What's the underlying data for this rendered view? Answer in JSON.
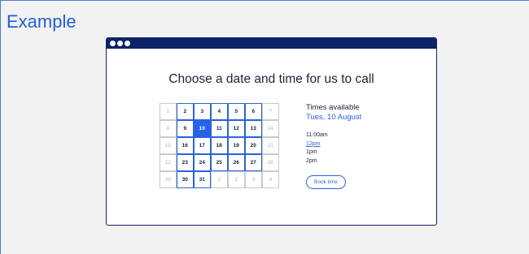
{
  "page": {
    "heading": "Example"
  },
  "window": {
    "title": "Choose a date and time for us to call"
  },
  "calendar": {
    "cells": [
      {
        "label": "1",
        "state": "muted"
      },
      {
        "label": "2",
        "state": "avail"
      },
      {
        "label": "3",
        "state": "avail"
      },
      {
        "label": "4",
        "state": "avail"
      },
      {
        "label": "5",
        "state": "avail"
      },
      {
        "label": "6",
        "state": "avail"
      },
      {
        "label": "7",
        "state": "muted"
      },
      {
        "label": "8",
        "state": "muted"
      },
      {
        "label": "9",
        "state": "avail"
      },
      {
        "label": "10",
        "state": "selected"
      },
      {
        "label": "11",
        "state": "avail"
      },
      {
        "label": "12",
        "state": "avail"
      },
      {
        "label": "13",
        "state": "avail"
      },
      {
        "label": "14",
        "state": "muted"
      },
      {
        "label": "15",
        "state": "muted"
      },
      {
        "label": "16",
        "state": "avail"
      },
      {
        "label": "17",
        "state": "avail"
      },
      {
        "label": "18",
        "state": "avail"
      },
      {
        "label": "19",
        "state": "avail"
      },
      {
        "label": "20",
        "state": "avail"
      },
      {
        "label": "21",
        "state": "muted"
      },
      {
        "label": "22",
        "state": "muted"
      },
      {
        "label": "23",
        "state": "avail"
      },
      {
        "label": "24",
        "state": "avail"
      },
      {
        "label": "25",
        "state": "avail"
      },
      {
        "label": "26",
        "state": "avail"
      },
      {
        "label": "27",
        "state": "avail"
      },
      {
        "label": "28",
        "state": "muted"
      },
      {
        "label": "29",
        "state": "muted"
      },
      {
        "label": "30",
        "state": "avail"
      },
      {
        "label": "31",
        "state": "avail"
      },
      {
        "label": "1",
        "state": "muted"
      },
      {
        "label": "2",
        "state": "muted"
      },
      {
        "label": "3",
        "state": "muted"
      },
      {
        "label": "4",
        "state": "muted"
      }
    ]
  },
  "times": {
    "title": "Times available",
    "date": "Tues, 10 August",
    "slots": [
      {
        "label": "11:00am",
        "link": false
      },
      {
        "label": "12pm",
        "link": true
      },
      {
        "label": "1pm",
        "link": false
      },
      {
        "label": "2pm",
        "link": false
      }
    ],
    "book_label": "Book time"
  },
  "colors": {
    "accent": "#2563eb",
    "navy": "#0c2466",
    "heading": "#1f5fd3"
  }
}
